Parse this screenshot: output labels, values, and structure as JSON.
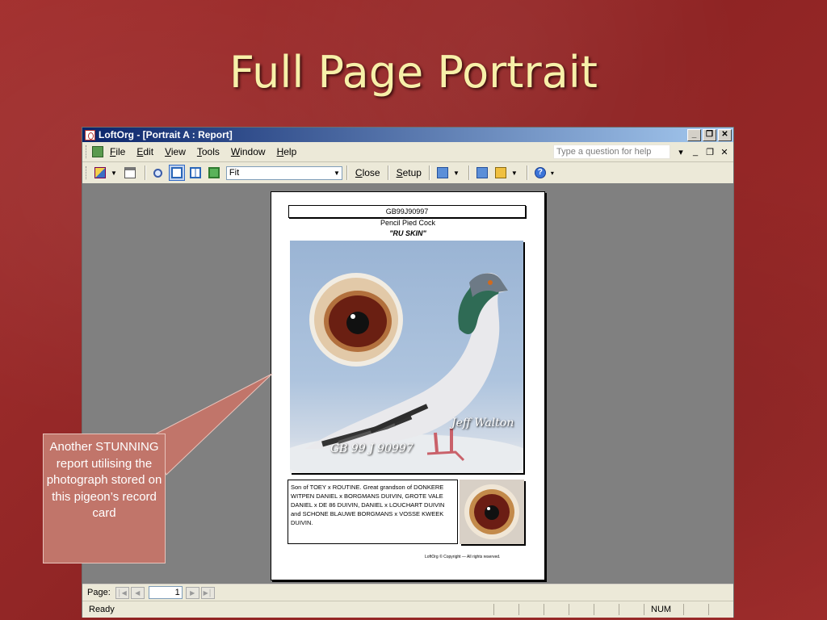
{
  "slide": {
    "title": "Full Page Portrait",
    "callout": "Another STUNNING report utilising the photograph stored on this pigeon’s record card"
  },
  "window": {
    "title": "LoftOrg - [Portrait A : Report]",
    "controls": [
      "_",
      "❐",
      "✕"
    ]
  },
  "menu": {
    "items": [
      {
        "hot": "F",
        "rest": "ile"
      },
      {
        "hot": "E",
        "rest": "dit"
      },
      {
        "hot": "V",
        "rest": "iew"
      },
      {
        "hot": "T",
        "rest": "ools"
      },
      {
        "hot": "W",
        "rest": "indow"
      },
      {
        "hot": "H",
        "rest": "elp"
      }
    ],
    "ask_placeholder": "Type a question for help"
  },
  "toolbar": {
    "zoom_value": "Fit",
    "close_hot": "C",
    "close_rest": "lose",
    "setup_hot": "S",
    "setup_rest": "etup"
  },
  "report": {
    "ring": "GB99J90997",
    "color_sex": "Pencil Pied Cock",
    "name": "\"RU SKIN\"",
    "photo_owner": "Jeff Walton",
    "photo_ring": "GB 99 J 90997",
    "description": "Son of TOEY x ROUTINE. Great grandson of DONKERE WITPEN DANIEL x BORGMANS DUIVIN, GROTE VALE DANIEL x DE 86 DUIVIN, DANIEL x LOUCHART DUIVIN and SCHONE BLAUWE BORGMANS x VOSSE KWEEK DUIVIN.",
    "copyright": "LoftOrg © Copyright — All rights reserved."
  },
  "pager": {
    "label": "Page:",
    "current_page": "1"
  },
  "status": {
    "left": "Ready",
    "num": "NUM"
  },
  "colors": {
    "background": "#9b2a2a",
    "title": "#f7f0a9",
    "callout": "#c1756a",
    "titlebar": "#0a246a"
  }
}
